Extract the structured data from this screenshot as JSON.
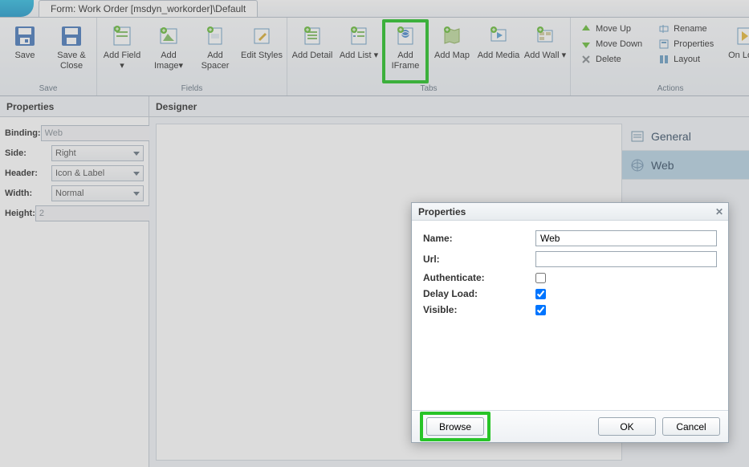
{
  "titlebar": {
    "tab_label": "Form: Work Order [msdyn_workorder]\\Default"
  },
  "ribbon": {
    "groups": {
      "save": {
        "label": "Save",
        "save": "Save",
        "save_close": "Save & Close"
      },
      "fields": {
        "label": "Fields",
        "add_field": "Add Field ▾",
        "add_image": "Add Image▾",
        "add_spacer": "Add Spacer",
        "edit_styles": "Edit Styles"
      },
      "tabs": {
        "label": "Tabs",
        "add_detail": "Add Detail",
        "add_list": "Add List ▾",
        "add_iframe": "Add IFrame",
        "add_map": "Add Map",
        "add_media": "Add Media",
        "add_wall": "Add Wall ▾"
      },
      "actions": {
        "label": "Actions",
        "move_up": "Move Up",
        "move_down": "Move Down",
        "delete": "Delete",
        "rename": "Rename",
        "properties": "Properties",
        "layout": "Layout",
        "on_load": "On Load"
      }
    }
  },
  "panels": {
    "properties": "Properties",
    "designer": "Designer"
  },
  "props": {
    "binding_label": "Binding:",
    "binding_value": "Web",
    "side_label": "Side:",
    "side_value": "Right",
    "header_label": "Header:",
    "header_value": "Icon & Label",
    "width_label": "Width:",
    "width_value": "Normal",
    "height_label": "Height:",
    "height_value": "2"
  },
  "side_items": [
    {
      "label": "General"
    },
    {
      "label": "Web"
    }
  ],
  "modal": {
    "title": "Properties",
    "name_label": "Name:",
    "name_value": "Web",
    "url_label": "Url:",
    "url_value": "",
    "auth_label": "Authenticate:",
    "delay_label": "Delay Load:",
    "visible_label": "Visible:",
    "browse": "Browse",
    "ok": "OK",
    "cancel": "Cancel"
  }
}
